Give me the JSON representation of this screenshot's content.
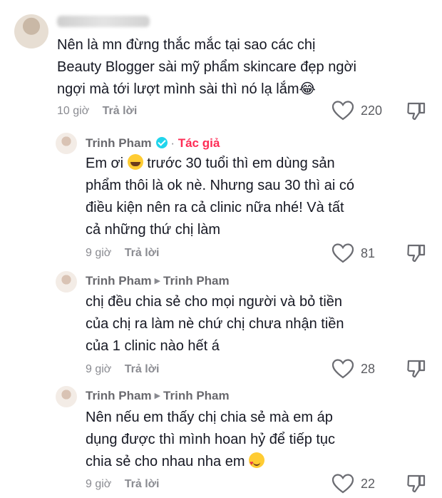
{
  "comments": [
    {
      "name": "",
      "text": "Nên là mn đừng thắc mắc tại sao các chị\nBeauty Blogger sài mỹ phẩm skincare đẹp ngời\nngợi mà tới lượt mình sài thì nó lạ lắm😂",
      "time": "10 giờ",
      "reply_label": "Trả lời",
      "likes": "220"
    },
    {
      "name": "Trinh Pham",
      "author_badge": "Tác giả",
      "text_parts": [
        "Em ơi",
        "trước 30 tuổi thì em dùng sản\nphẩm thôi là ok nè. Nhưng sau 30 thì ai có\nđiều kiện nên ra cả clinic nữa nhé! Và tất\ncả những thứ chị làm"
      ],
      "time": "9 giờ",
      "reply_label": "Trả lời",
      "likes": "81"
    },
    {
      "name": "Trinh Pham",
      "reply_to": "Trinh Pham",
      "text": "chị đều chia sẻ cho mọi người và bỏ tiền\ncủa chị ra làm nè chứ chị chưa nhận tiền\ncủa 1 clinic nào hết á",
      "time": "9 giờ",
      "reply_label": "Trả lời",
      "likes": "28"
    },
    {
      "name": "Trinh Pham",
      "reply_to": "Trinh Pham",
      "text": "Nên nếu em thấy chị chia sẻ mà em áp\ndụng được thì mình hoan hỷ để tiếp tục\nchia sẻ cho nhau nha em",
      "time": "9 giờ",
      "reply_label": "Trả lời",
      "likes": "22"
    }
  ],
  "icons": {
    "like": "heart-outline-icon",
    "dislike": "thumbs-down-icon",
    "verified": "verified-badge-icon"
  },
  "colors": {
    "author": "#fe2c55",
    "verified": "#20d5ec"
  }
}
